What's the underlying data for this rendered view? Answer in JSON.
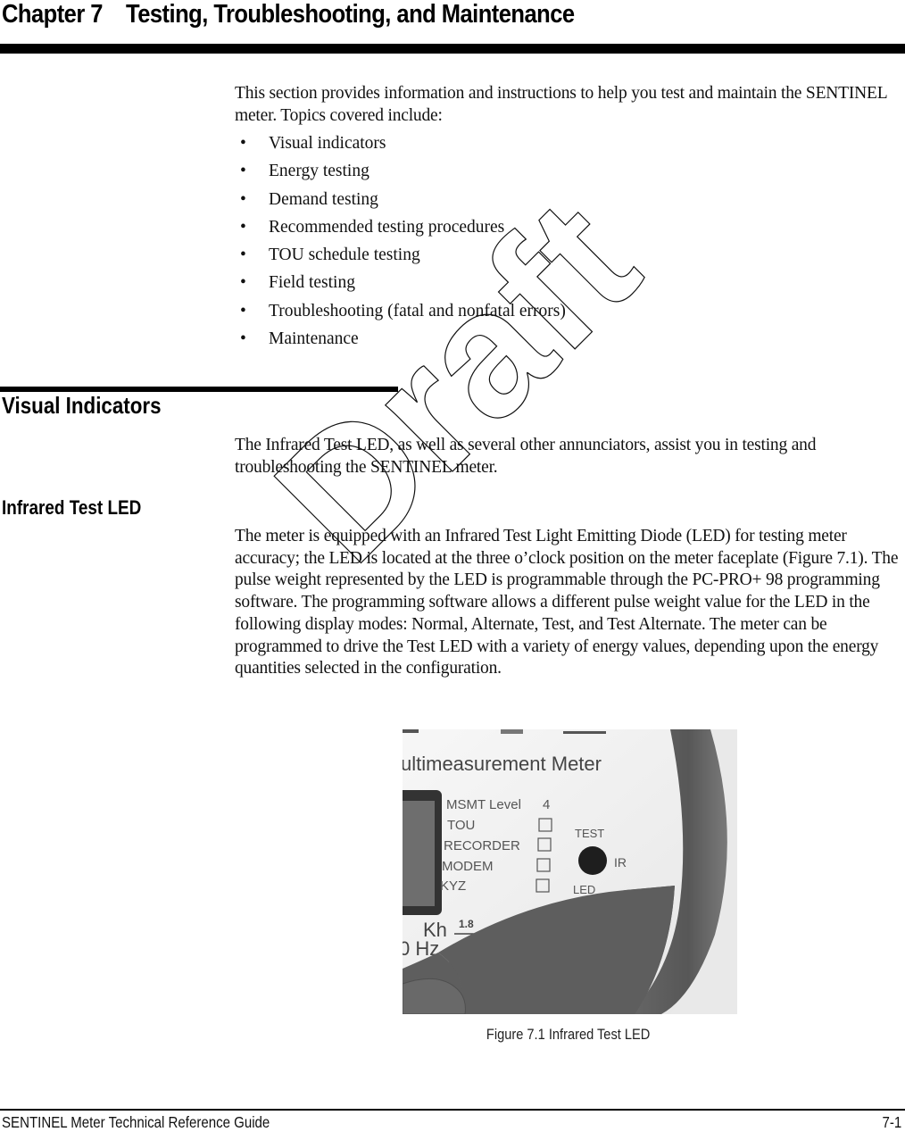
{
  "header": {
    "chapter_label": "Chapter 7",
    "chapter_title": "Testing, Troubleshooting, and Maintenance"
  },
  "intro": {
    "paragraph": "This section provides information and instructions to help you test and maintain the SENTINEL meter. Topics covered include:",
    "bullet_glyph": "•",
    "topics": [
      "Visual indicators",
      "Energy testing",
      "Demand testing",
      "Recommended testing procedures",
      "TOU schedule testing",
      "Field testing",
      "Troubleshooting (fatal and nonfatal errors)",
      "Maintenance"
    ]
  },
  "visual_indicators": {
    "heading": "Visual Indicators",
    "paragraph": "The Infrared Test LED, as well as several other annunciators, assist you in testing and troubleshooting the SENTINEL meter."
  },
  "infrared_test_led": {
    "heading": "Infrared Test LED",
    "paragraph": "The meter is equipped with an Infrared Test Light Emitting Diode (LED) for testing meter accuracy; the LED is located at the three o’clock position on the meter faceplate (Figure 7.1). The pulse weight represented by the LED is programmable through the PC-PRO+ 98 programming software. The programming software allows a different pulse weight value for the LED in the following display modes: Normal, Alternate, Test, and Test Alternate. The meter can be programmed to drive the Test LED with a variety of energy values, depending upon the energy quantities selected in the configuration."
  },
  "figure": {
    "photo_text": {
      "title": "ultimeasurement Meter",
      "msmt_level_label": "MSMT Level",
      "msmt_level_value": "4",
      "annunciators": [
        "TOU",
        "RECORDER",
        "MODEM",
        "KYZ"
      ],
      "led_top_label": "TEST",
      "led_side_label": "IR",
      "led_bottom_label": "LED",
      "kh_label": "Kh",
      "kh_value": "1.8",
      "hz_label": "0 Hz"
    },
    "caption": "Figure 7.1 Infrared Test LED"
  },
  "footer": {
    "guide_title": "SENTINEL Meter Technical Reference Guide",
    "page_number": "7-1"
  },
  "watermark": {
    "text": "Draft"
  },
  "colors": {
    "text": "#111111",
    "rule": "#000000",
    "meter_bezel": "#5a5a5a",
    "meter_face": "#f2f2f2"
  }
}
